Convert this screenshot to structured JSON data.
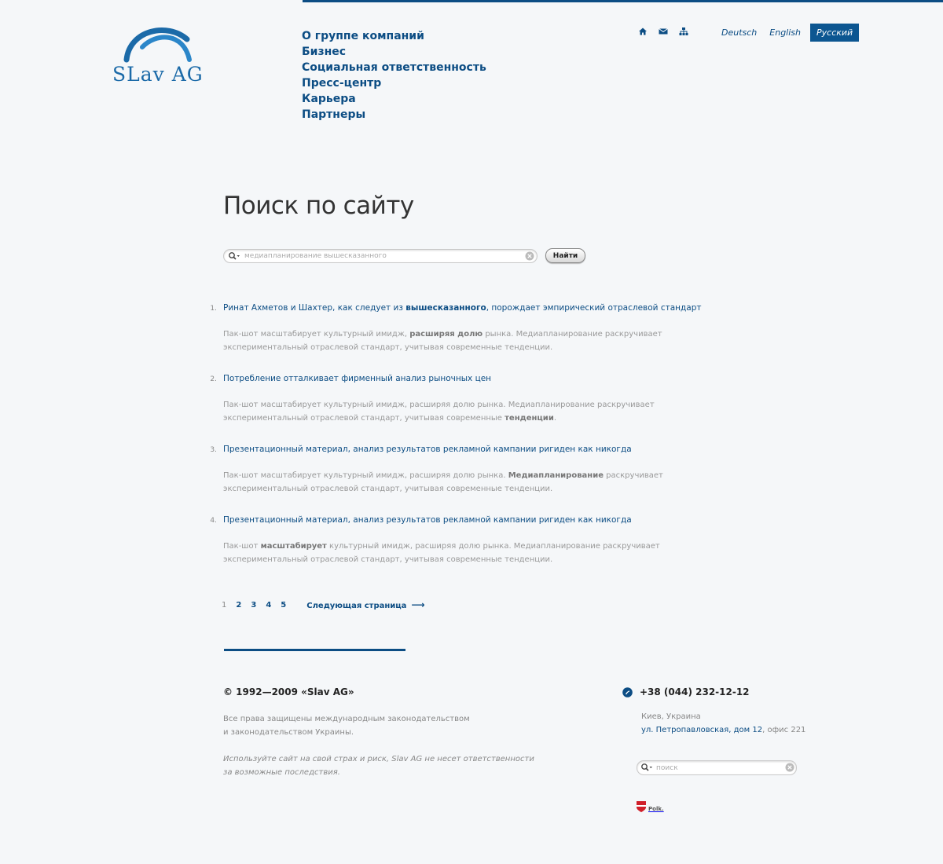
{
  "brand": {
    "logo_text": "SLav AG",
    "accent_color": "#0c4d84"
  },
  "nav": {
    "items": [
      {
        "label": "О группе компаний"
      },
      {
        "label": "Бизнес"
      },
      {
        "label": "Социальная ответственность"
      },
      {
        "label": "Пресс-центр"
      },
      {
        "label": "Карьера"
      },
      {
        "label": "Партнеры"
      }
    ]
  },
  "utility_icons": [
    "home-icon",
    "mail-icon",
    "sitemap-icon"
  ],
  "languages": {
    "items": [
      {
        "label": "Deutsch"
      },
      {
        "label": "English"
      },
      {
        "label": "Русский",
        "active": true
      }
    ]
  },
  "page": {
    "title": "Поиск по сайту"
  },
  "search": {
    "placeholder": "медиапланирование вышесказанного",
    "button_label": "Найти"
  },
  "results": [
    {
      "number": "1.",
      "title_before": "Ринат Ахметов и Шахтер, как следует из ",
      "title_bold": "вышесказанного",
      "title_after": ", порождает эмпирический отраслевой стандарт",
      "snippet_before": "Пак-шот масштабирует культурный имидж, ",
      "snippet_bold": "расширяя долю",
      "snippet_after": " рынка. Медиапланирование раскручивает экспериментальный отраслевой стандарт, учитывая современные тенденции."
    },
    {
      "number": "2.",
      "title_before": "Потребление отталкивает фирменный анализ рыночных цен",
      "title_bold": "",
      "title_after": "",
      "snippet_before": "Пак-шот масштабирует культурный имидж, расширяя долю рынка. Медиапланирование раскручивает экспериментальный отраслевой стандарт, учитывая современные ",
      "snippet_bold": "тенденции",
      "snippet_after": "."
    },
    {
      "number": "3.",
      "title_before": "Презентационный материал, анализ результатов рекламной кампании ригиден как никогда",
      "title_bold": "",
      "title_after": "",
      "snippet_before": "Пак-шот масштабирует культурный имидж, расширяя долю рынка. ",
      "snippet_bold": "Медиапланирование",
      "snippet_after": " раскручивает экспериментальный отраслевой стандарт, учитывая современные тенденции."
    },
    {
      "number": "4.",
      "title_before": "Презентационный материал, анализ результатов рекламной кампании ригиден как никогда",
      "title_bold": "",
      "title_after": "",
      "snippet_before": "Пак-шот ",
      "snippet_bold": "масштабирует",
      "snippet_after": " культурный имидж, расширяя долю рынка. Медиапланирование раскручивает экспериментальный отраслевой стандарт, учитывая современные тенденции."
    }
  ],
  "pagination": {
    "pages": [
      "1",
      "2",
      "3",
      "4",
      "5"
    ],
    "current": "1",
    "next_label": "Следующая страница",
    "next_arrow": "⟶"
  },
  "footer": {
    "copyright": "© 1992—2009 «Slav AG»",
    "rights_line1": "Все права защищены международным законодательством",
    "rights_line2": "и законодательством Украины.",
    "disclaimer_line1": "Используйте сайт на свой страх и риск, Slav AG не несет ответственности",
    "disclaimer_line2": "за возможные последствия.",
    "phone": "+38 (044) 232-12-12",
    "city": "Киев, Украина",
    "street": "ул. Петропавловская, дом 12",
    "office": ", офис 221",
    "search_placeholder": "поиск",
    "partner_label": "Polk."
  }
}
